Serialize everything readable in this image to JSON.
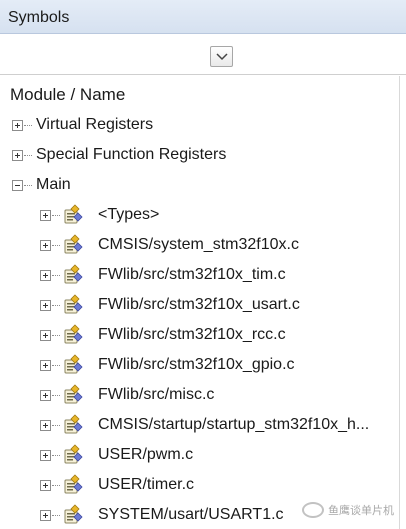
{
  "panel": {
    "title": "Symbols"
  },
  "toolbar": {
    "dropdown_icon": "chevron-down-icon"
  },
  "tree": {
    "column_header": "Module / Name",
    "root_items": [
      {
        "label": "Virtual Registers",
        "expander": "plus"
      },
      {
        "label": "Special Function Registers",
        "expander": "plus"
      },
      {
        "label": "Main",
        "expander": "minus"
      }
    ],
    "main_children": [
      {
        "label": "<Types>",
        "icon": "module-icon"
      },
      {
        "label": "CMSIS/system_stm32f10x.c",
        "icon": "module-icon"
      },
      {
        "label": "FWlib/src/stm32f10x_tim.c",
        "icon": "module-icon"
      },
      {
        "label": "FWlib/src/stm32f10x_usart.c",
        "icon": "module-icon"
      },
      {
        "label": "FWlib/src/stm32f10x_rcc.c",
        "icon": "module-icon"
      },
      {
        "label": "FWlib/src/stm32f10x_gpio.c",
        "icon": "module-icon"
      },
      {
        "label": "FWlib/src/misc.c",
        "icon": "module-icon"
      },
      {
        "label": "CMSIS/startup/startup_stm32f10x_h...",
        "icon": "module-icon"
      },
      {
        "label": "USER/pwm.c",
        "icon": "module-icon"
      },
      {
        "label": "USER/timer.c",
        "icon": "module-icon"
      },
      {
        "label": "SYSTEM/usart/USART1.c",
        "icon": "module-icon"
      }
    ]
  },
  "watermark": {
    "text": "鱼鹰谈单片机"
  }
}
